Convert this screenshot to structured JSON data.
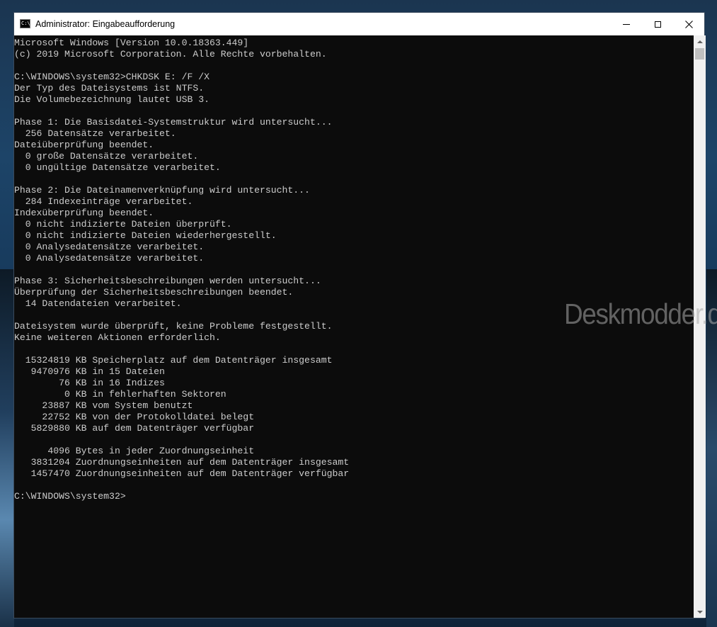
{
  "window": {
    "title": "Administrator: Eingabeaufforderung",
    "icon": "console-icon",
    "controls": [
      "minimize-icon",
      "maximize-icon",
      "close-icon"
    ]
  },
  "console": {
    "lines": [
      "Microsoft Windows [Version 10.0.18363.449]",
      "(c) 2019 Microsoft Corporation. Alle Rechte vorbehalten.",
      "",
      "C:\\WINDOWS\\system32>CHKDSK E: /F /X",
      "Der Typ des Dateisystems ist NTFS.",
      "Die Volumebezeichnung lautet USB 3.",
      "",
      "Phase 1: Die Basisdatei-Systemstruktur wird untersucht...",
      "  256 Datensätze verarbeitet.",
      "Dateiüberprüfung beendet.",
      "  0 große Datensätze verarbeitet.",
      "  0 ungültige Datensätze verarbeitet.",
      "",
      "Phase 2: Die Dateinamenverknüpfung wird untersucht...",
      "  284 Indexeinträge verarbeitet.",
      "Indexüberprüfung beendet.",
      "  0 nicht indizierte Dateien überprüft.",
      "  0 nicht indizierte Dateien wiederhergestellt.",
      "  0 Analysedatensätze verarbeitet.",
      "  0 Analysedatensätze verarbeitet.",
      "",
      "Phase 3: Sicherheitsbeschreibungen werden untersucht...",
      "Überprüfung der Sicherheitsbeschreibungen beendet.",
      "  14 Datendateien verarbeitet.",
      "",
      "Dateisystem wurde überprüft, keine Probleme festgestellt.",
      "Keine weiteren Aktionen erforderlich.",
      "",
      "  15324819 KB Speicherplatz auf dem Datenträger insgesamt",
      "   9470976 KB in 15 Dateien",
      "        76 KB in 16 Indizes",
      "         0 KB in fehlerhaften Sektoren",
      "     23887 KB vom System benutzt",
      "     22752 KB von der Protokolldatei belegt",
      "   5829880 KB auf dem Datenträger verfügbar",
      "",
      "      4096 Bytes in jeder Zuordnungseinheit",
      "   3831204 Zuordnungseinheiten auf dem Datenträger insgesamt",
      "   1457470 Zuordnungseinheiten auf dem Datenträger verfügbar",
      "",
      "C:\\WINDOWS\\system32>"
    ]
  },
  "watermark": "Deskmodder.de",
  "colors": {
    "console_bg": "#0c0c0c",
    "console_fg": "#cccccc",
    "titlebar_bg": "#ffffff"
  }
}
